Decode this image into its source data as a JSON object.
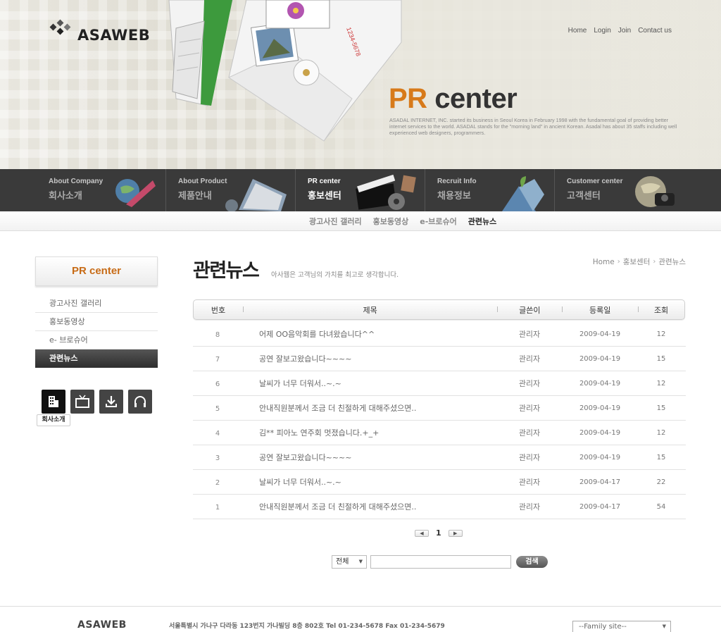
{
  "header": {
    "logo": "ASAWEB",
    "top_links": [
      "Home",
      "Login",
      "Join",
      "Contact us"
    ],
    "pr_title_pr": "PR",
    "pr_title_rest": " center",
    "pr_desc": "ASADAL INTERNET, INC. started its business in Seoul Korea in February 1998 with the fundamental goal of providing better internet services to the world. ASADAL stands for the \"morning land\" in ancient Korean. Asadal has about 35 staffs including well experienced web designers, programmers."
  },
  "gnb": [
    {
      "en": "About Company",
      "ko": "회사소개"
    },
    {
      "en": "About Product",
      "ko": "제품안내"
    },
    {
      "en": "PR center",
      "ko": "홍보센터"
    },
    {
      "en": "Recruit Info",
      "ko": "채용정보"
    },
    {
      "en": "Customer center",
      "ko": "고객센터"
    }
  ],
  "subnav": [
    "광고사진 갤러리",
    "홍보동영상",
    "e-브로슈어",
    "관련뉴스"
  ],
  "sidebar": {
    "title": "PR center",
    "items": [
      "광고사진 갤러리",
      "홍보동영상",
      "e- 브로슈어",
      "관련뉴스"
    ],
    "quick_tooltip": "회사소개"
  },
  "content": {
    "title": "관련뉴스",
    "subtitle": "아사웹은 고객님의 가치를 최고로 생각합니다.",
    "breadcrumb": [
      "Home",
      "홍보센터",
      "관련뉴스"
    ],
    "columns": [
      "번호",
      "제목",
      "글쓴이",
      "등록일",
      "조회"
    ],
    "rows": [
      {
        "no": "8",
        "title": "어제 OO음악회를 다녀왔습니다^^",
        "writer": "관리자",
        "date": "2009-04-19",
        "hits": "12"
      },
      {
        "no": "7",
        "title": "공연 잘보고왔습니다~~~~",
        "writer": "관리자",
        "date": "2009-04-19",
        "hits": "15"
      },
      {
        "no": "6",
        "title": "날씨가 너무 더워서..~.~",
        "writer": "관리자",
        "date": "2009-04-19",
        "hits": "12"
      },
      {
        "no": "5",
        "title": "안내직원분께서 조금 더 친절하게 대해주셨으면..",
        "writer": "관리자",
        "date": "2009-04-19",
        "hits": "15"
      },
      {
        "no": "4",
        "title": "김** 피아노 연주회 멋졌습니다.+_+",
        "writer": "관리자",
        "date": "2009-04-19",
        "hits": "12"
      },
      {
        "no": "3",
        "title": "공연 잘보고왔습니다~~~~",
        "writer": "관리자",
        "date": "2009-04-19",
        "hits": "15"
      },
      {
        "no": "2",
        "title": "날씨가 너무 더워서..~.~",
        "writer": "관리자",
        "date": "2009-04-17",
        "hits": "22"
      },
      {
        "no": "1",
        "title": "안내직원분께서 조금 더 친절하게 대해주셨으면..",
        "writer": "관리자",
        "date": "2009-04-17",
        "hits": "54"
      }
    ],
    "paging": {
      "prev": "◀",
      "current": "1",
      "next": "▶"
    },
    "search": {
      "select": "전체",
      "input_value": "",
      "button": "검색"
    }
  },
  "footer": {
    "logo": "ASAWEB",
    "address": "서울특별시 가나구 다라동 123번지 가나빌딩 8층 802호   Tel  01-234-5678   Fax  01-234-5679",
    "family_site": "--Family site--"
  },
  "colors": {
    "accent": "#d77a1a",
    "nav_bg": "#3a3a3a"
  }
}
